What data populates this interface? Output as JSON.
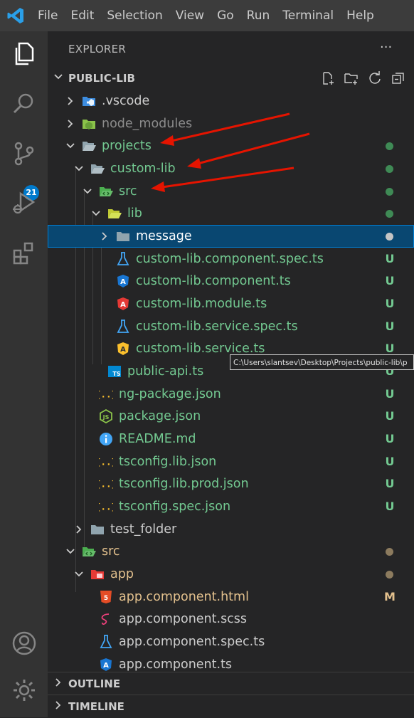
{
  "menubar": {
    "items": [
      "File",
      "Edit",
      "Selection",
      "View",
      "Go",
      "Run",
      "Terminal",
      "Help"
    ]
  },
  "activitybar": {
    "icons": [
      "files-icon",
      "search-icon",
      "source-control-icon",
      "run-debug-icon",
      "extensions-icon",
      "account-icon",
      "gear-icon"
    ],
    "scm_badge": "21",
    "accent": "#007acc"
  },
  "explorer": {
    "title": "EXPLORER",
    "more": "···",
    "workspace": "PUBLIC-LIB"
  },
  "colors": {
    "untracked": "#73c991",
    "modified": "#e2c08d",
    "default": "#cccccc",
    "ignored": "#8c8c8c",
    "selection": "#094771",
    "arrow": "#e51400"
  },
  "tree": [
    {
      "label": ".vscode",
      "deco": ""
    },
    {
      "label": "node_modules",
      "deco": ""
    },
    {
      "label": "projects",
      "deco": ""
    },
    {
      "label": "custom-lib",
      "deco": ""
    },
    {
      "label": "src",
      "deco": ""
    },
    {
      "label": "lib",
      "deco": ""
    },
    {
      "label": "message",
      "deco": ""
    },
    {
      "label": "custom-lib.component.spec.ts",
      "deco": "U"
    },
    {
      "label": "custom-lib.component.ts",
      "deco": "U"
    },
    {
      "label": "custom-lib.module.ts",
      "deco": "U"
    },
    {
      "label": "custom-lib.service.spec.ts",
      "deco": "U"
    },
    {
      "label": "custom-lib.service.ts",
      "deco": "U"
    },
    {
      "label": "public-api.ts",
      "deco": "U"
    },
    {
      "label": "ng-package.json",
      "deco": "U"
    },
    {
      "label": "package.json",
      "deco": "U"
    },
    {
      "label": "README.md",
      "deco": "U"
    },
    {
      "label": "tsconfig.lib.json",
      "deco": "U"
    },
    {
      "label": "tsconfig.lib.prod.json",
      "deco": "U"
    },
    {
      "label": "tsconfig.spec.json",
      "deco": "U"
    },
    {
      "label": "test_folder",
      "deco": ""
    },
    {
      "label": "src",
      "deco": ""
    },
    {
      "label": "app",
      "deco": ""
    },
    {
      "label": "app.component.html",
      "deco": "M"
    },
    {
      "label": "app.component.scss",
      "deco": ""
    },
    {
      "label": "app.component.spec.ts",
      "deco": ""
    },
    {
      "label": "app.component.ts",
      "deco": ""
    }
  ],
  "tooltip": "C:\\Users\\slantsev\\Desktop\\Projects\\public-lib\\p",
  "panels": {
    "outline": "OUTLINE",
    "timeline": "TIMELINE"
  }
}
